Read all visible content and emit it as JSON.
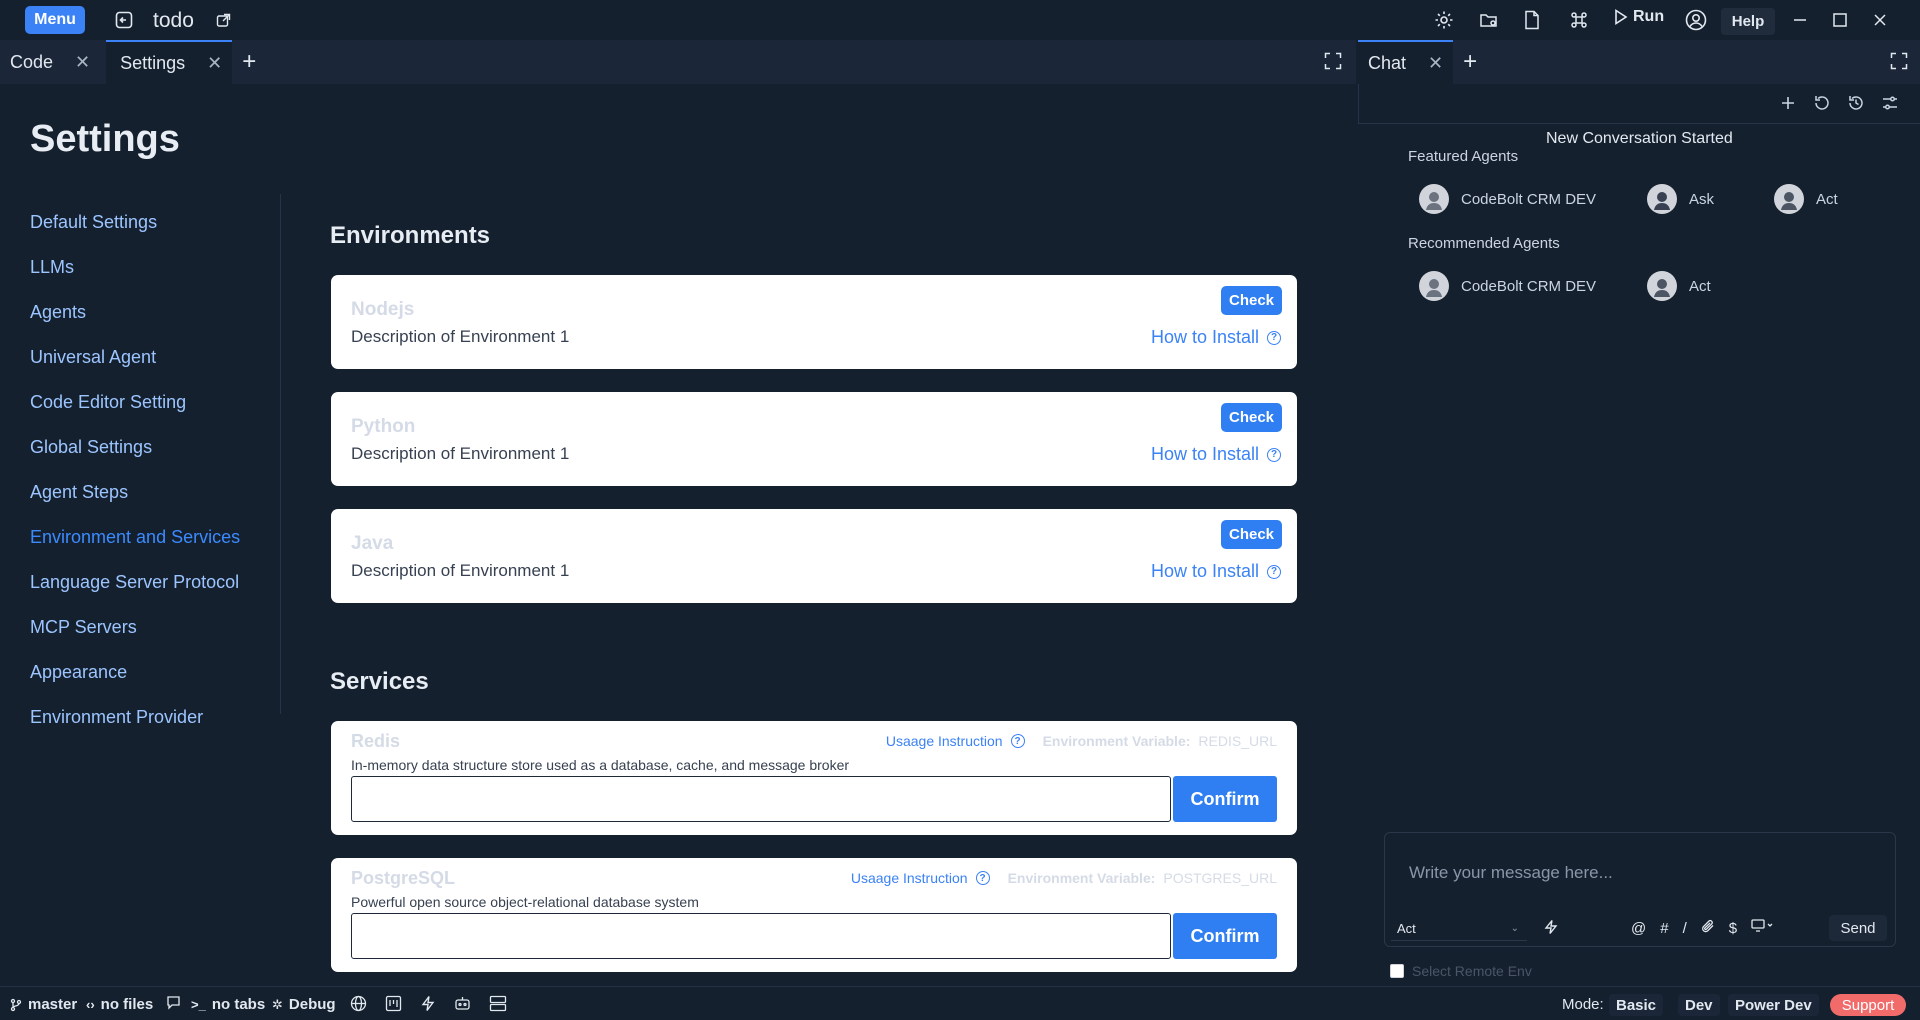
{
  "titlebar": {
    "menu_label": "Menu",
    "app_name": "todo",
    "run_label": "Run",
    "help_label": "Help",
    "icons": [
      "back-icon",
      "external-link-icon",
      "gear-icon",
      "folder-gear-icon",
      "file-icon",
      "command-icon",
      "play-icon",
      "user-circle-icon",
      "minimize-icon",
      "maximize-icon",
      "close-icon"
    ]
  },
  "editor_tabs": [
    {
      "label": "Code",
      "active": false
    },
    {
      "label": "Settings",
      "active": true
    }
  ],
  "chat_tabs": [
    {
      "label": "Chat",
      "active": true
    }
  ],
  "settings": {
    "title": "Settings",
    "nav": [
      {
        "label": "Default Settings",
        "active": false
      },
      {
        "label": "LLMs",
        "active": false
      },
      {
        "label": "Agents",
        "active": false
      },
      {
        "label": "Universal Agent",
        "active": false
      },
      {
        "label": "Code Editor Setting",
        "active": false
      },
      {
        "label": "Global Settings",
        "active": false
      },
      {
        "label": "Agent Steps",
        "active": false
      },
      {
        "label": "Environment and Services",
        "active": true
      },
      {
        "label": "Language Server Protocol",
        "active": false
      },
      {
        "label": "MCP Servers",
        "active": false
      },
      {
        "label": "Appearance",
        "active": false
      },
      {
        "label": "Environment Provider",
        "active": false
      }
    ],
    "environments_title": "Environments",
    "environments": [
      {
        "name": "Nodejs",
        "description": "Description of Environment 1",
        "check_label": "Check",
        "howto_label": "How to Install"
      },
      {
        "name": "Python",
        "description": "Description of Environment 1",
        "check_label": "Check",
        "howto_label": "How to Install"
      },
      {
        "name": "Java",
        "description": "Description of Environment 1",
        "check_label": "Check",
        "howto_label": "How to Install"
      }
    ],
    "services_title": "Services",
    "services": [
      {
        "name": "Redis",
        "description": "In-memory data structure store used as a database, cache, and message broker",
        "usage_label": "Usaage Instruction",
        "envvar_label": "Environment Variable:",
        "envvar_value": "REDIS_URL",
        "input_value": "",
        "confirm_label": "Confirm"
      },
      {
        "name": "PostgreSQL",
        "description": "Powerful open source object-relational database system",
        "usage_label": "Usaage Instruction",
        "envvar_label": "Environment Variable:",
        "envvar_value": "POSTGRES_URL",
        "input_value": "",
        "confirm_label": "Confirm"
      }
    ]
  },
  "chat": {
    "conversation_status": "New Conversation Started",
    "featured_title": "Featured Agents",
    "featured_agents": [
      "CodeBolt CRM DEV",
      "Ask",
      "Act"
    ],
    "recommended_title": "Recommended Agents",
    "recommended_agents": [
      "CodeBolt CRM DEV",
      "Act"
    ],
    "message_placeholder": "Write your message here...",
    "selected_agent": "Act",
    "tool_symbols": [
      "@",
      "#",
      "/",
      "$"
    ],
    "send_label": "Send",
    "remote_env_label": "Select Remote Env"
  },
  "statusbar": {
    "branch": "master",
    "files": "no files",
    "tabs": "no tabs",
    "debug": "Debug",
    "mode_label": "Mode:",
    "modes": [
      "Basic",
      "Dev",
      "Power Dev"
    ],
    "support_label": "Support"
  },
  "colors": {
    "background": "#15202e",
    "accent": "#3b82f6",
    "active_nav": "#3b8bff",
    "support": "#f26b6b"
  }
}
